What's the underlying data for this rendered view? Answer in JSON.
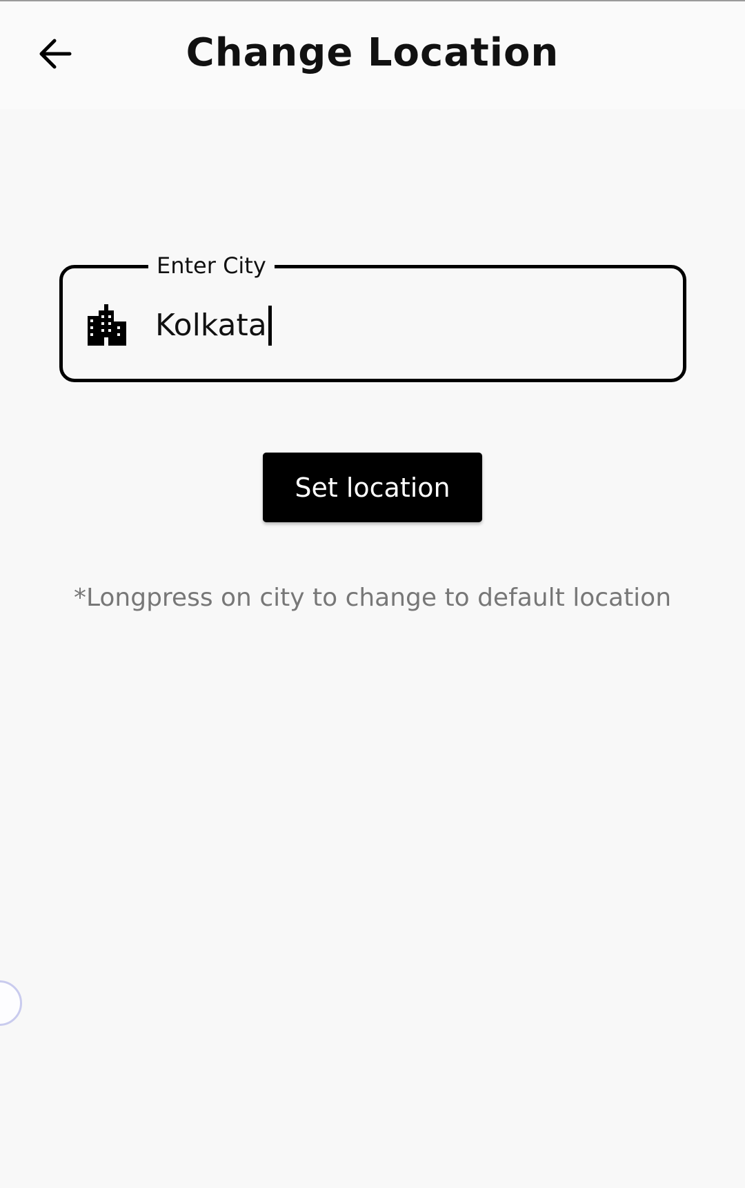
{
  "header": {
    "title": "Change Location",
    "back_icon": "arrow-left-icon"
  },
  "city_field": {
    "label": "Enter City",
    "value": "Kolkata",
    "icon": "city-buildings-icon"
  },
  "actions": {
    "set_location_label": "Set location"
  },
  "hint": "*Longpress on city to change to default location",
  "colors": {
    "primary": "#000000",
    "background": "#f8f8f8",
    "hint_text": "#777777"
  }
}
